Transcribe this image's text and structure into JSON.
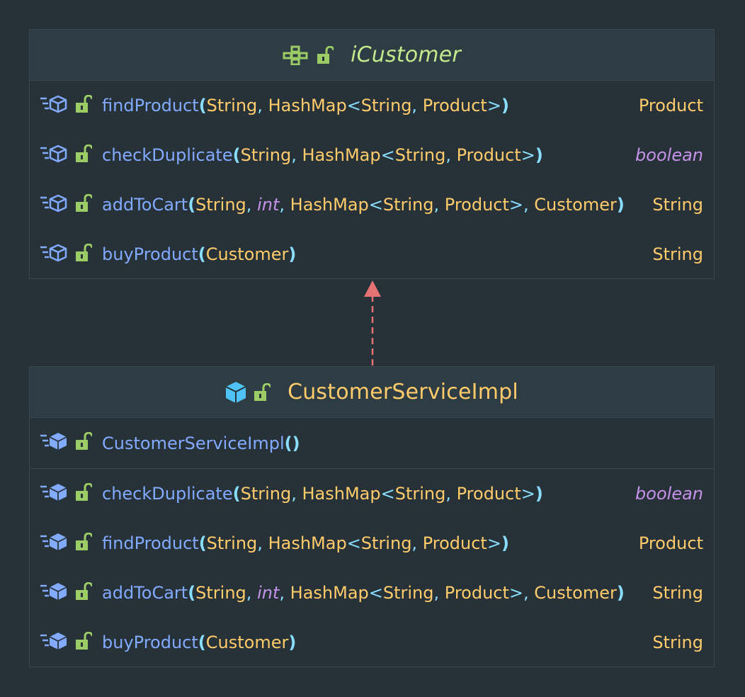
{
  "colors": {
    "background": "#263238",
    "header_background": "#2e3c43",
    "border": "#37474f",
    "interface_title": "#c3e88d",
    "class_title": "#ffcb6b",
    "method_name": "#82aaff",
    "type": "#ffcb6b",
    "punctuation": "#89ddff",
    "keyword": "#c792ea",
    "icon_green": "#9ccc65",
    "icon_blue": "#4fc3f7",
    "method_icon": "#82aaff",
    "arrow": "#e57373"
  },
  "interface_box": {
    "title": "iCustomer",
    "title_icons": [
      "interface-icon",
      "unlocked-icon"
    ],
    "methods": [
      {
        "name": "findProduct",
        "return": "Product"
      },
      {
        "name": "checkDuplicate",
        "return": "boolean"
      },
      {
        "name": "addToCart",
        "return": "String"
      },
      {
        "name": "buyProduct",
        "return": "String"
      }
    ]
  },
  "class_box": {
    "title": "CustomerServiceImpl",
    "title_icons": [
      "class-icon",
      "unlocked-icon"
    ],
    "constructor": {
      "name": "CustomerServiceImpl"
    },
    "methods": [
      {
        "name": "checkDuplicate",
        "return": "boolean"
      },
      {
        "name": "findProduct",
        "return": "Product"
      },
      {
        "name": "addToCart",
        "return": "String"
      },
      {
        "name": "buyProduct",
        "return": "String"
      }
    ]
  },
  "tokens": {
    "open": "(",
    "close": ")",
    "comma": ",",
    "lt": "<",
    "gt": ">",
    "String": "String",
    "HashMap": "HashMap",
    "Product": "Product",
    "Customer": "Customer",
    "int": "int"
  },
  "relation": {
    "type": "implements",
    "style": "dashed",
    "head": "hollow-triangle"
  }
}
